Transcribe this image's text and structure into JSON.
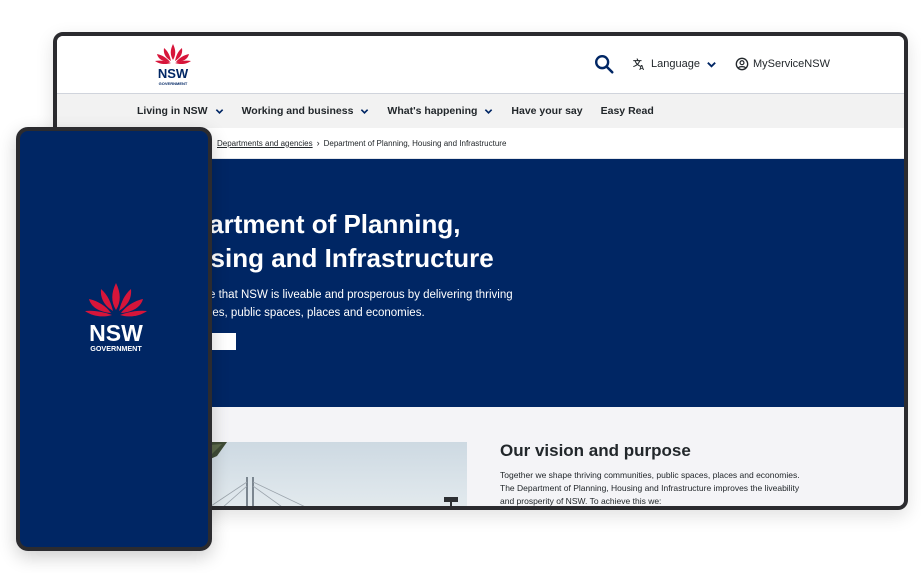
{
  "header": {
    "logo_text": "NSW",
    "logo_subtext": "GOVERNMENT",
    "language_label": "Language",
    "account_label": "MyServiceNSW",
    "icons": [
      "search-icon",
      "translate-icon",
      "chevron-down-icon",
      "user-circle-icon"
    ]
  },
  "nav": {
    "items": [
      {
        "label": "Living in NSW",
        "has_menu": true
      },
      {
        "label": "Working and business",
        "has_menu": true
      },
      {
        "label": "What's happening",
        "has_menu": true
      },
      {
        "label": "Have your say",
        "has_menu": false
      },
      {
        "label": "Easy Read",
        "has_menu": false
      }
    ]
  },
  "breadcrumb": {
    "link": "Departments and agencies",
    "current": "Department of Planning, Housing and Infrastructure"
  },
  "hero": {
    "title_line1": "Department of Planning,",
    "title_line2": "Housing and Infrastructure",
    "text": "We ensure that NSW is liveable and prosperous by delivering thriving communities, public spaces, places and economies.",
    "button_icon": "play-icon"
  },
  "vision": {
    "title": "Our vision and purpose",
    "text": "Together we shape thriving communities, public spaces, places and economies. The Department of Planning, Housing and Infrastructure improves the liveability and prosperity of NSW. To achieve this we:"
  },
  "phone": {
    "logo_text": "NSW",
    "logo_subtext": "GOVERNMENT"
  },
  "colors": {
    "brand_navy": "#002664",
    "waratah_red": "#d7153a",
    "nav_bg": "#f2f2f2",
    "text_dark": "#22272b"
  }
}
